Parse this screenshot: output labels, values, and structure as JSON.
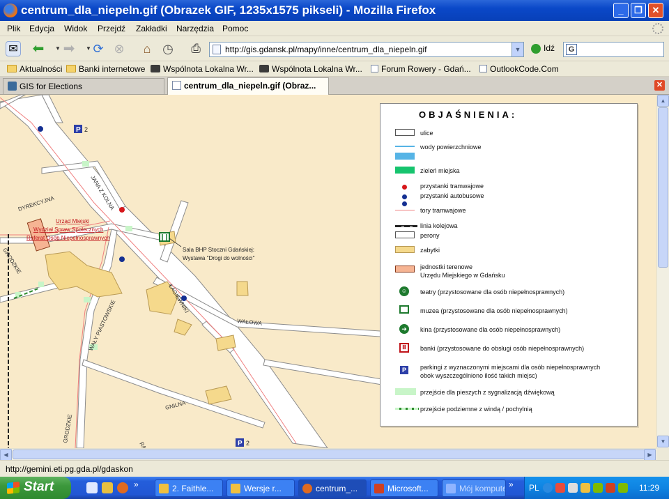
{
  "window": {
    "title": "centrum_dla_niepeln.gif (Obrazek GIF, 1235x1575 pikseli) - Mozilla Firefox",
    "minimize": "_",
    "maximize": "❐",
    "close": "✕"
  },
  "menu": {
    "items": [
      "Plik",
      "Edycja",
      "Widok",
      "Przejdź",
      "Zakładki",
      "Narzędzia",
      "Pomoc"
    ]
  },
  "toolbar": {
    "url": "http://gis.gdansk.pl/mapy/inne/centrum_dla_niepeln.gif",
    "go_label": "Idź",
    "search_engine_icon": "G"
  },
  "bookmarks": [
    {
      "label": "Aktualności",
      "icon": "folder-icon"
    },
    {
      "label": "Banki internetowe",
      "icon": "folder-icon"
    },
    {
      "label": "Wspólnota Lokalna Wr...",
      "icon": "wspolnota-icon"
    },
    {
      "label": "Wspólnota Lokalna Wr...",
      "icon": "wspolnota-icon"
    },
    {
      "label": "Forum Rowery - Gdań...",
      "icon": "page-icon"
    },
    {
      "label": "OutlookCode.Com",
      "icon": "page-icon"
    }
  ],
  "tabs": [
    {
      "label": "GIS for Elections",
      "active": false
    },
    {
      "label": "centrum_dla_niepeln.gif (Obraz...",
      "active": true
    }
  ],
  "map": {
    "streets": [
      "DYREKCYJNA",
      "JANA Z KOLNA",
      "GRODZKIE",
      "WAŁY PIASTOWSKIE",
      "ŁAGIEWNIKI",
      "WAŁOWA",
      "GNILNA",
      "GRODZKIE",
      "RA"
    ],
    "office_label_lines": [
      "Urząd Miejski",
      "Wydział Spraw Społecznych",
      "Referat Osób Niepełnosprawnych"
    ],
    "museum_label_lines": [
      "Sala BHP Stoczni Gdańskiej:",
      "Wystawa \"Drogi do wolności\""
    ],
    "parking_labels": [
      "P 2",
      "P 2"
    ]
  },
  "legend": {
    "title": "OBJAŚNIENIA:",
    "items": [
      {
        "symbol": "street-box",
        "text": "ulice"
      },
      {
        "symbol": "water-line",
        "text": "wody powierzchniowe"
      },
      {
        "symbol": "water-area",
        "text": ""
      },
      {
        "symbol": "green-area",
        "text": "zieleń miejska"
      },
      {
        "symbol": "tram-stop",
        "text": "przystanki tramwajowe"
      },
      {
        "symbol": "bus-stop",
        "text": "przystanki autobusowe"
      },
      {
        "symbol": "tram-track",
        "text": "tory tramwajowe"
      },
      {
        "symbol": "rail-line",
        "text": "linia kolejowa"
      },
      {
        "symbol": "platform-box",
        "text": "perony"
      },
      {
        "symbol": "monument-box",
        "text": "zabytki"
      },
      {
        "symbol": "office-box",
        "text": "jednostki terenowe\nUrzędu Miejskiego w Gdańsku"
      },
      {
        "symbol": "theatre-icon",
        "text": "teatry (przystosowane dla osób niepełnosprawnych)"
      },
      {
        "symbol": "museum-icon",
        "text": "muzea (przystosowane dla osób niepełnosprawnych)"
      },
      {
        "symbol": "cinema-icon",
        "text": "kina (przystosowane dla osób niepełnosprawnych)"
      },
      {
        "symbol": "bank-icon",
        "text": "banki (przystosowane do obsługi osób niepełnosprawnych)"
      },
      {
        "symbol": "parking-icon",
        "text": "parkingi z wyznaczonymi miejscami dla osób niepełnosprawnych\nobok wyszczególniono ilość takich miejsc)"
      },
      {
        "symbol": "crossing-sound",
        "text": "przejście dla pieszych z sygnalizacją dźwiękową"
      },
      {
        "symbol": "underpass",
        "text": "przejście podziemne z windą / pochylnią"
      }
    ]
  },
  "status": {
    "text": "http://gemini.eti.pg.gda.pl/gdaskon"
  },
  "taskbar": {
    "start_label": "Start",
    "overflow_left": "»",
    "tasks": [
      {
        "label": "2. Faithle...",
        "active": false
      },
      {
        "label": "Wersje r...",
        "active": false
      },
      {
        "label": "centrum_...",
        "active": true
      },
      {
        "label": "Microsoft...",
        "active": false
      },
      {
        "label": "Mój komputer",
        "active": false
      }
    ],
    "overflow_right": "»",
    "tray_lang": "PL",
    "clock": "11:29"
  },
  "colors": {
    "map_background": "#f9eac9",
    "street_fill": "#ffffff",
    "monument": "#f5d98c",
    "office": "#f6b493",
    "water": "#56b4e6",
    "green": "#16c46e",
    "tram_stop": "#d6171b",
    "bus_stop": "#142f92",
    "crossing": "#c8f5c8"
  }
}
